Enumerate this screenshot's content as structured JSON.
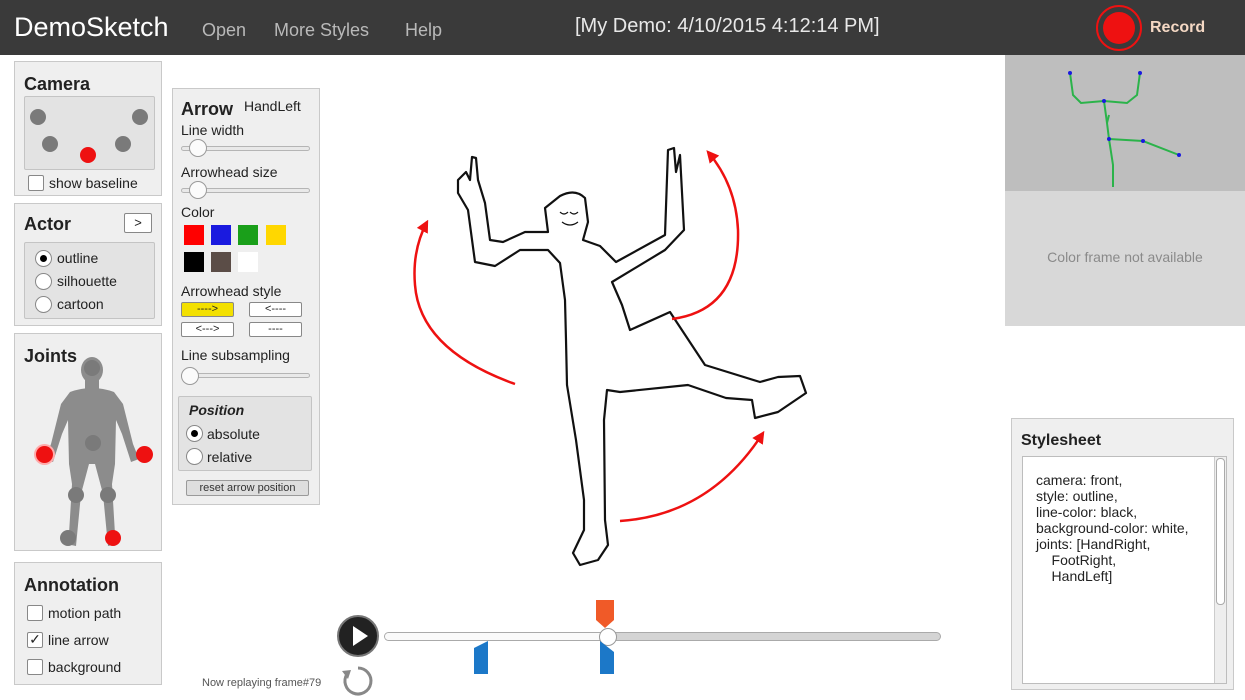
{
  "header": {
    "app_title": "DemoSketch",
    "menu": [
      "Open",
      "More Styles",
      "Help"
    ],
    "document_title": "[My Demo: 4/10/2015 4:12:14 PM]",
    "record_label": "Record"
  },
  "camera": {
    "title": "Camera",
    "show_baseline_label": "show baseline",
    "show_baseline_checked": false
  },
  "actor": {
    "title": "Actor",
    "next_button": ">",
    "options": [
      "outline",
      "silhouette",
      "cartoon"
    ],
    "selected": "outline"
  },
  "joints": {
    "title": "Joints"
  },
  "annotation": {
    "title": "Annotation",
    "options": [
      {
        "label": "motion path",
        "checked": false
      },
      {
        "label": "line arrow",
        "checked": true
      },
      {
        "label": "background",
        "checked": false
      }
    ]
  },
  "arrow": {
    "title": "Arrow",
    "joint_name": "HandLeft",
    "line_width_label": "Line width",
    "arrowhead_size_label": "Arrowhead size",
    "color_label": "Color",
    "colors": [
      "#ff0000",
      "#1a1adf",
      "#1a9f1a",
      "#ffd700",
      "#000000",
      "#5b4d47",
      "#ffffff"
    ],
    "selected_color": "#ff0000",
    "arrowhead_style_label": "Arrowhead style",
    "styles": [
      "---->",
      "<----",
      "<--->",
      "----"
    ],
    "selected_style": "---->",
    "line_subsampling_label": "Line subsampling",
    "position_title": "Position",
    "position_options": [
      "absolute",
      "relative"
    ],
    "position_selected": "absolute",
    "reset_button": "reset arrow position"
  },
  "playback": {
    "status_text": "Now replaying frame#79",
    "progress": 0.4
  },
  "preview": {
    "color_frame_text": "Color frame not available"
  },
  "stylesheet": {
    "title": "Stylesheet",
    "lines": [
      "camera: front,",
      "style: outline,",
      "line-color: black,",
      "background-color: white,",
      "joints: [HandRight,",
      "    FootRight,",
      "    HandLeft]"
    ]
  },
  "colors": {
    "accent_red": "#ee1111",
    "topbar": "#3a3a3a",
    "timeline_marker_orange": "#f05a28",
    "timeline_marker_blue": "#1c78c8"
  }
}
